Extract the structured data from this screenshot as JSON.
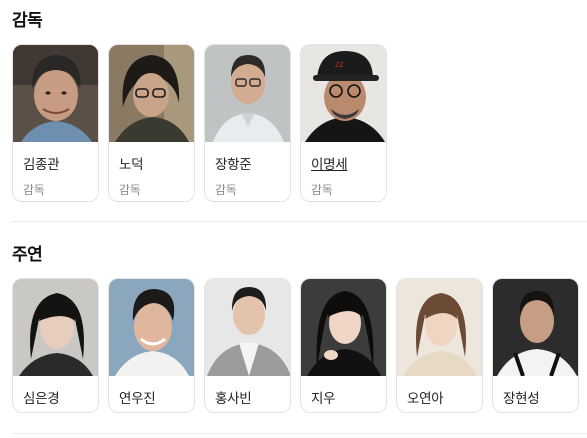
{
  "sections": {
    "directors": {
      "title": "감독",
      "items": [
        {
          "name": "김종관",
          "role": "감독",
          "photo": "portrait-man-grey-hair-smiling"
        },
        {
          "name": "노덕",
          "role": "감독",
          "photo": "portrait-woman-glasses-dark-hair"
        },
        {
          "name": "장항준",
          "role": "감독",
          "photo": "portrait-man-glasses-white-shirt"
        },
        {
          "name": "이명세",
          "role": "감독",
          "photo": "portrait-man-black-cap-glasses"
        }
      ]
    },
    "cast": {
      "title": "주연",
      "items": [
        {
          "name": "심은경",
          "photo": "portrait-woman-black-hair-bangs"
        },
        {
          "name": "연우진",
          "photo": "portrait-man-smiling"
        },
        {
          "name": "홍사빈",
          "photo": "portrait-man-grey-blazer"
        },
        {
          "name": "지우",
          "photo": "portrait-woman-long-black-hair"
        },
        {
          "name": "오연아",
          "photo": "portrait-woman-light-background"
        },
        {
          "name": "장현성",
          "photo": "portrait-man-chef-apron"
        }
      ]
    }
  },
  "colors": {
    "card_border": "#e3e3e3",
    "role_text": "#8a8a8a",
    "divider": "#ececec"
  }
}
